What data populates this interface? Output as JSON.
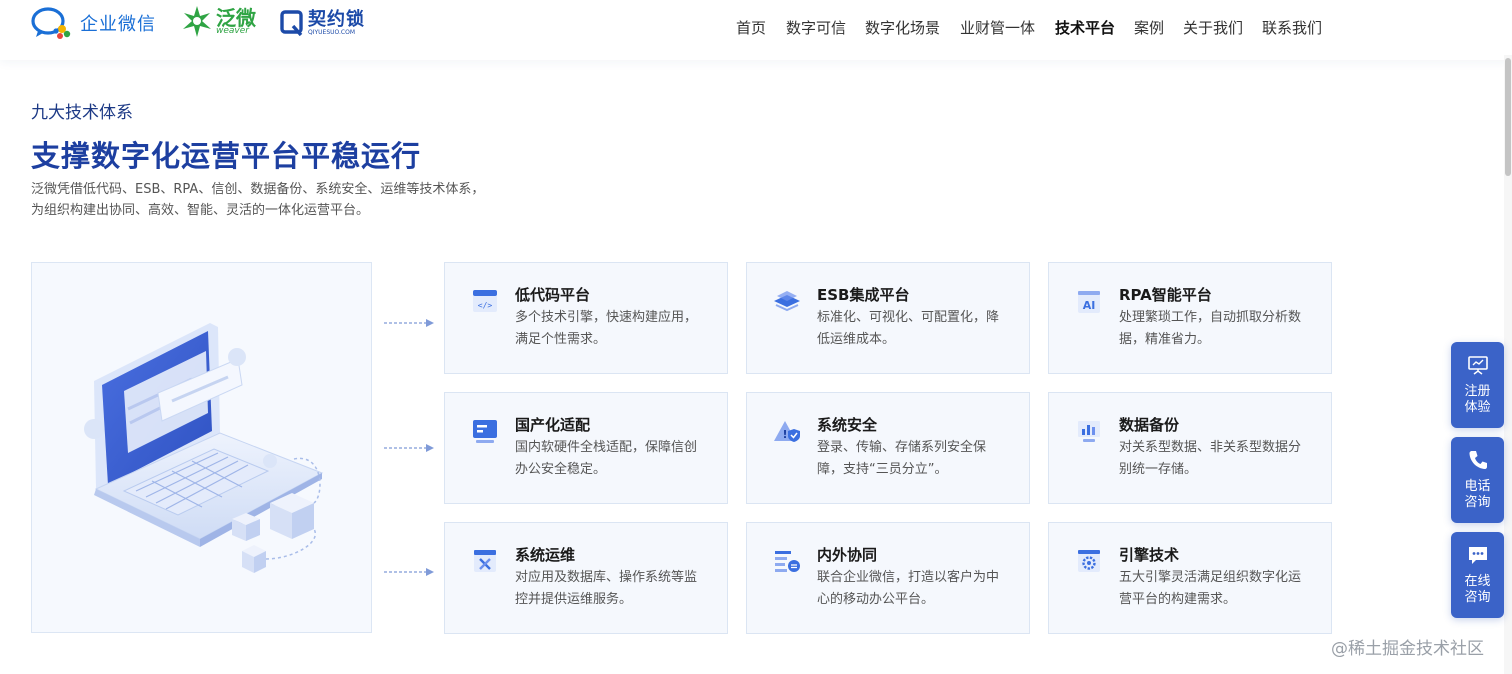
{
  "header": {
    "logos": [
      {
        "name": "企业微信"
      },
      {
        "name": "泛微",
        "sub": "weaver"
      },
      {
        "name": "契约锁",
        "sub": "QIYUESUO.COM"
      }
    ],
    "nav": [
      "首页",
      "数字可信",
      "数字化场景",
      "业财管一体",
      "技术平台",
      "案例",
      "关于我们",
      "联系我们"
    ],
    "active_nav": "技术平台"
  },
  "intro": {
    "eyebrow": "九大技术体系",
    "headline": "支撑数字化运营平台平稳运行",
    "desc_line1": "泛微凭借低代码、ESB、RPA、信创、数据备份、系统安全、运维等技术体系，",
    "desc_line2": "为组织构建出协同、高效、智能、灵活的一体化运营平台。"
  },
  "cards": [
    {
      "icon": "code-window-icon",
      "title": "低代码平台",
      "desc": "多个技术引擎，快速构建应用，满足个性需求。"
    },
    {
      "icon": "layers-icon",
      "title": "ESB集成平台",
      "desc": "标准化、可视化、可配置化，降低运维成本。"
    },
    {
      "icon": "ai-chip-icon",
      "title": "RPA智能平台",
      "desc": "处理繁琐工作，自动抓取分析数据，精准省力。"
    },
    {
      "icon": "localization-icon",
      "title": "国产化适配",
      "desc": "国内软硬件全栈适配，保障信创办公安全稳定。"
    },
    {
      "icon": "shield-alert-icon",
      "title": "系统安全",
      "desc": "登录、传输、存储系列安全保障，支持“三员分立”。"
    },
    {
      "icon": "bar-chart-icon",
      "title": "数据备份",
      "desc": "对关系型数据、非关系型数据分别统一存储。"
    },
    {
      "icon": "tools-icon",
      "title": "系统运维",
      "desc": "对应用及数据库、操作系统等监控并提供运维服务。"
    },
    {
      "icon": "collab-list-icon",
      "title": "内外协同",
      "desc": "联合企业微信，打造以客户为中心的移动办公平台。"
    },
    {
      "icon": "engine-gear-icon",
      "title": "引擎技术",
      "desc": "五大引擎灵活满足组织数字化运营平台的构建需求。"
    }
  ],
  "float": [
    {
      "icon": "presentation-icon",
      "line1": "注册",
      "line2": "体验"
    },
    {
      "icon": "phone-icon",
      "line1": "电话",
      "line2": "咨询"
    },
    {
      "icon": "chat-icon",
      "line1": "在线",
      "line2": "咨询"
    }
  ],
  "watermark": "@稀土掘金技术社区",
  "colors": {
    "primary": "#3b63c8",
    "heading": "#1d3fa0",
    "card_bg": "#f5f8fd",
    "card_border": "#dbe5f3"
  }
}
